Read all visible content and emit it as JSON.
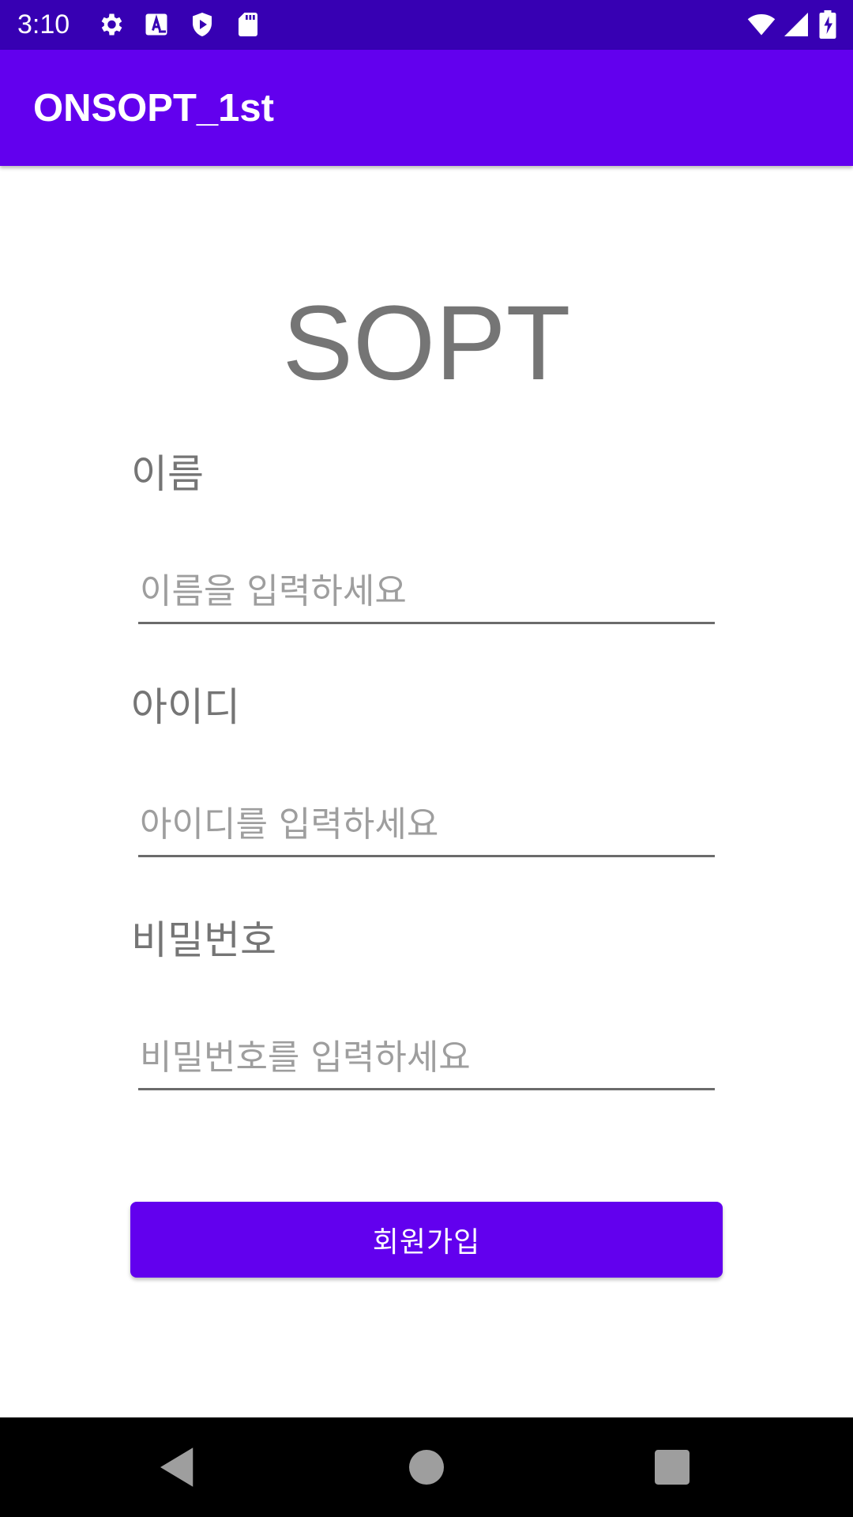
{
  "status_bar": {
    "time": "3:10",
    "left_icons": [
      "gear-icon",
      "text-a-icon",
      "shield-play-icon",
      "sd-card-icon"
    ],
    "right_icons": [
      "wifi-icon",
      "signal-icon",
      "battery-charging-icon"
    ],
    "background": "#3700B3"
  },
  "app_bar": {
    "title": "ONSOPT_1st",
    "background": "#6200EE"
  },
  "main": {
    "logo": "SOPT",
    "fields": [
      {
        "label": "이름",
        "placeholder": "이름을 입력하세요",
        "value": ""
      },
      {
        "label": "아이디",
        "placeholder": "아이디를 입력하세요",
        "value": ""
      },
      {
        "label": "비밀번호",
        "placeholder": "비밀번호를 입력하세요",
        "value": ""
      }
    ],
    "signup_button": "회원가입",
    "accent": "#6200EE"
  },
  "nav_bar": {
    "buttons": [
      "back-icon",
      "home-icon",
      "recents-icon"
    ]
  }
}
